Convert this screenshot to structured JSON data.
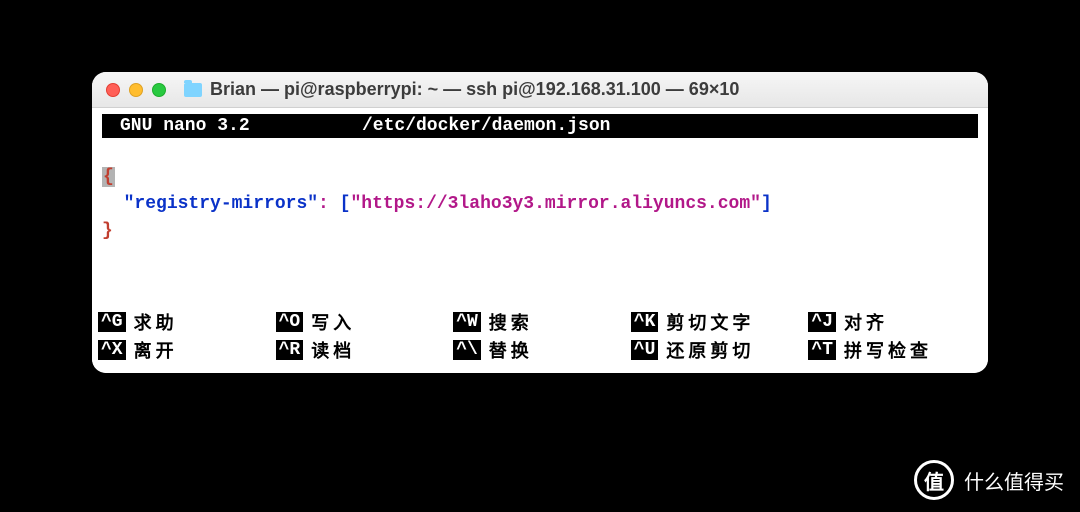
{
  "window": {
    "title": "Brian — pi@raspberrypi: ~ — ssh pi@192.168.31.100 — 69×10"
  },
  "nano": {
    "app": "GNU nano 3.2",
    "filepath": "/etc/docker/daemon.json"
  },
  "content": {
    "brace_open": "{",
    "indent": "  ",
    "key": "\"registry-mirrors\"",
    "colon": ": ",
    "bracket_open": "[",
    "url": "\"https://3laho3y3.mirror.aliyuncs.com\"",
    "bracket_close": "]",
    "brace_close": "}"
  },
  "help": {
    "row1": [
      {
        "key": "^G",
        "label": "求助"
      },
      {
        "key": "^O",
        "label": "写入"
      },
      {
        "key": "^W",
        "label": "搜索"
      },
      {
        "key": "^K",
        "label": "剪切文字"
      },
      {
        "key": "^J",
        "label": "对齐"
      }
    ],
    "row2": [
      {
        "key": "^X",
        "label": "离开"
      },
      {
        "key": "^R",
        "label": "读档"
      },
      {
        "key": "^\\",
        "label": "替换"
      },
      {
        "key": "^U",
        "label": "还原剪切"
      },
      {
        "key": "^T",
        "label": "拼写检查"
      }
    ]
  },
  "watermark": {
    "symbol": "值",
    "text": "什么值得买"
  }
}
